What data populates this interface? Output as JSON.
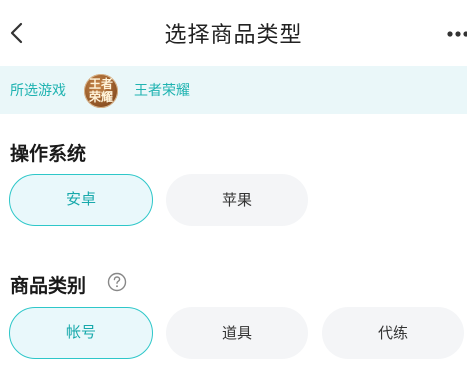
{
  "header": {
    "title": "选择商品类型"
  },
  "game_bar": {
    "label": "所选游戏",
    "avatar_line1": "王者",
    "avatar_line2": "荣耀",
    "game_name": "王者荣耀"
  },
  "os_section": {
    "title": "操作系统",
    "options": [
      {
        "label": "安卓",
        "selected": true
      },
      {
        "label": "苹果",
        "selected": false
      }
    ]
  },
  "category_section": {
    "title": "商品类别",
    "options": [
      {
        "label": "帐号",
        "selected": true
      },
      {
        "label": "道具",
        "selected": false
      },
      {
        "label": "代练",
        "selected": false
      }
    ]
  },
  "colors": {
    "accent": "#2ec7c9",
    "accent_text": "#17a9ab",
    "bar_bg": "#eaf7f9",
    "chip_bg": "#f4f5f7"
  }
}
